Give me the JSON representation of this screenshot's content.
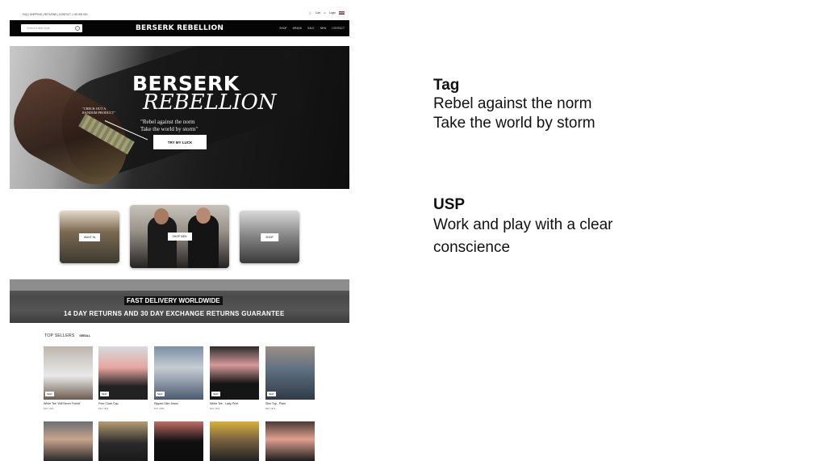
{
  "site": {
    "topbar": {
      "links": "FAQ | SHIPPING | RETURNS | CONTACT | +45 000 000",
      "cart": "Cart",
      "account": "Login"
    },
    "search_placeholder": "Search entire store",
    "brand": "BERSERK REBELLION",
    "nav": [
      "SHOP",
      "BRAND",
      "SALE",
      "NEW",
      "CONTACT"
    ],
    "hero": {
      "title_line1": "BERSERK",
      "title_line2": "REBELLION",
      "quote_line1": "\"Rebel against the norm",
      "quote_line2": "Take the world by storm\"",
      "note": "\"CHECK OUT A RANDOM PRODUCT\"",
      "cta": "TRY MY LUCK"
    },
    "cards": [
      "WANT IN",
      "SHOP MEN",
      "SHOP"
    ],
    "banner": {
      "line1": "FAST DELIVERY WORLDWIDE",
      "line2": "14 DAY RETURNS AND 30 DAY EXCHANGE RETURNS GUARANTEE"
    },
    "top_sellers": {
      "title": "TOP SELLERS",
      "subtitle": "SEEALL",
      "products": [
        {
          "name": "White Tee 'Will Never Forfeit'",
          "price": "$40  |  $32"
        },
        {
          "name": "Free Chair Cap",
          "price": "$40  |  $32"
        },
        {
          "name": "Ripped Slim Jeans",
          "price": "$70  |  $56"
        },
        {
          "name": "White Tee - Lady Print",
          "price": "$40  |  $32"
        },
        {
          "name": "Slim Top - Plain",
          "price": "$40  |  $32"
        }
      ]
    }
  },
  "annotations": {
    "tag": {
      "heading": "Tag",
      "lines": [
        "Rebel against the norm",
        "Take the world by storm"
      ]
    },
    "usp": {
      "heading": "USP",
      "lines": [
        "Work and play with a clear",
        "conscience"
      ]
    }
  }
}
